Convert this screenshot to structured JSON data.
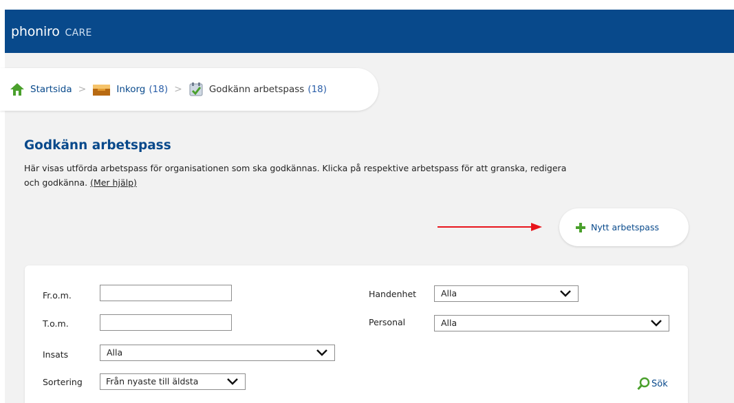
{
  "app": {
    "logo_main": "phoniro",
    "logo_sub": "CARE"
  },
  "breadcrumb": [
    {
      "label": "Startsida",
      "count": "",
      "icon": "home-icon"
    },
    {
      "label": "Inkorg",
      "count": "(18)",
      "icon": "inbox-icon"
    },
    {
      "label": "Godkänn arbetspass",
      "count": "(18)",
      "icon": "approve-icon"
    }
  ],
  "page": {
    "title": "Godkänn arbetspass",
    "description": "Här visas utförda arbetspass för organisationen som ska godkännas. Klicka på respektive arbetspass för att granska, redigera och godkänna.",
    "help_link": "(Mer hjälp)"
  },
  "actions": {
    "new_label": "Nytt arbetspass"
  },
  "filters": {
    "from_label": "Fr.o.m.",
    "from_value": "",
    "to_label": "T.o.m.",
    "to_value": "",
    "insats_label": "Insats",
    "insats_value": "Alla",
    "sort_label": "Sortering",
    "sort_value": "Från nyaste till äldsta",
    "handenhet_label": "Handenhet",
    "handenhet_value": "Alla",
    "personal_label": "Personal",
    "personal_value": "Alla",
    "search_label": "Sök"
  },
  "colors": {
    "header": "#08498b",
    "accent": "#08498b",
    "arrow": "#e8141b",
    "plus": "#4aa02c"
  }
}
